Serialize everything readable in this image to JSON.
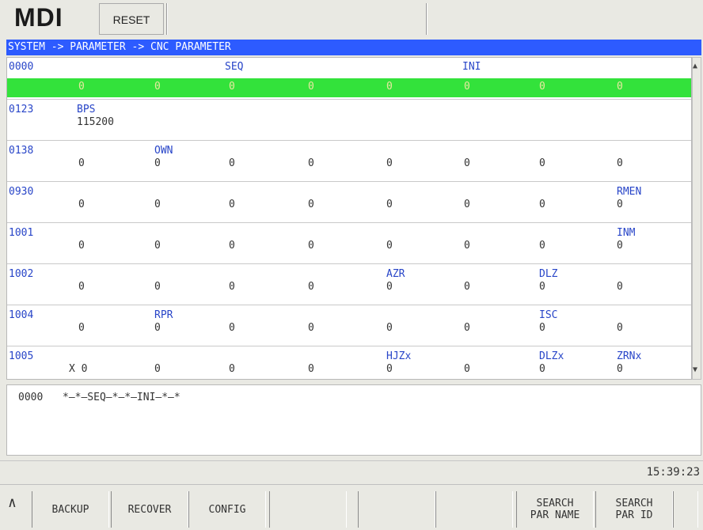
{
  "top": {
    "mode": "MDI",
    "reset_label": "RESET"
  },
  "breadcrumb": "SYSTEM -> PARAMETER -> CNC PARAMETER",
  "table": {
    "rows": [
      {
        "id": "0000",
        "selected": true,
        "cells": [
          [
            "",
            ""
          ],
          [
            "",
            ""
          ],
          [
            "SEQ",
            "0"
          ],
          [
            "",
            ""
          ],
          [
            "",
            ""
          ],
          [
            "INI",
            "0"
          ],
          [
            "",
            ""
          ],
          [
            "",
            ""
          ]
        ],
        "values": [
          "0",
          "0",
          "0",
          "0",
          "0",
          "0",
          "0",
          "0"
        ]
      },
      {
        "id": "0123",
        "wide": true,
        "name": "BPS",
        "value": "115200"
      },
      {
        "id": "0138",
        "names": [
          "",
          "OWN",
          "",
          "",
          "",
          "",
          "",
          ""
        ],
        "values": [
          "0",
          "0",
          "0",
          "0",
          "0",
          "0",
          "0",
          "0"
        ]
      },
      {
        "id": "0930",
        "names": [
          "",
          "",
          "",
          "",
          "",
          "",
          "",
          "RMEN"
        ],
        "values": [
          "0",
          "0",
          "0",
          "0",
          "0",
          "0",
          "0",
          "0"
        ]
      },
      {
        "id": "1001",
        "names": [
          "",
          "",
          "",
          "",
          "",
          "",
          "",
          "INM"
        ],
        "values": [
          "0",
          "0",
          "0",
          "0",
          "0",
          "0",
          "0",
          "0"
        ]
      },
      {
        "id": "1002",
        "names": [
          "",
          "",
          "",
          "",
          "AZR",
          "",
          "DLZ",
          ""
        ],
        "values": [
          "0",
          "0",
          "0",
          "0",
          "0",
          "0",
          "0",
          "0"
        ]
      },
      {
        "id": "1004",
        "names": [
          "",
          "RPR",
          "",
          "",
          "",
          "",
          "ISC",
          ""
        ],
        "values": [
          "0",
          "0",
          "0",
          "0",
          "0",
          "0",
          "0",
          "0"
        ]
      },
      {
        "id": "1005",
        "names": [
          "",
          "",
          "",
          "",
          "HJZx",
          "",
          "DLZx",
          "ZRNx"
        ],
        "values": [
          "X 0",
          "0",
          "0",
          "0",
          "0",
          "0",
          "0",
          "0"
        ]
      }
    ]
  },
  "description": {
    "id": "0000",
    "text": "*—*—SEQ—*—*—INI—*—*"
  },
  "status": {
    "time": "15:39:23"
  },
  "softkeys": {
    "up": "∧",
    "keys": [
      "BACKUP",
      "RECOVER",
      "CONFIG",
      "",
      "",
      "",
      "SEARCH\nPAR NAME",
      "SEARCH\nPAR ID"
    ]
  }
}
